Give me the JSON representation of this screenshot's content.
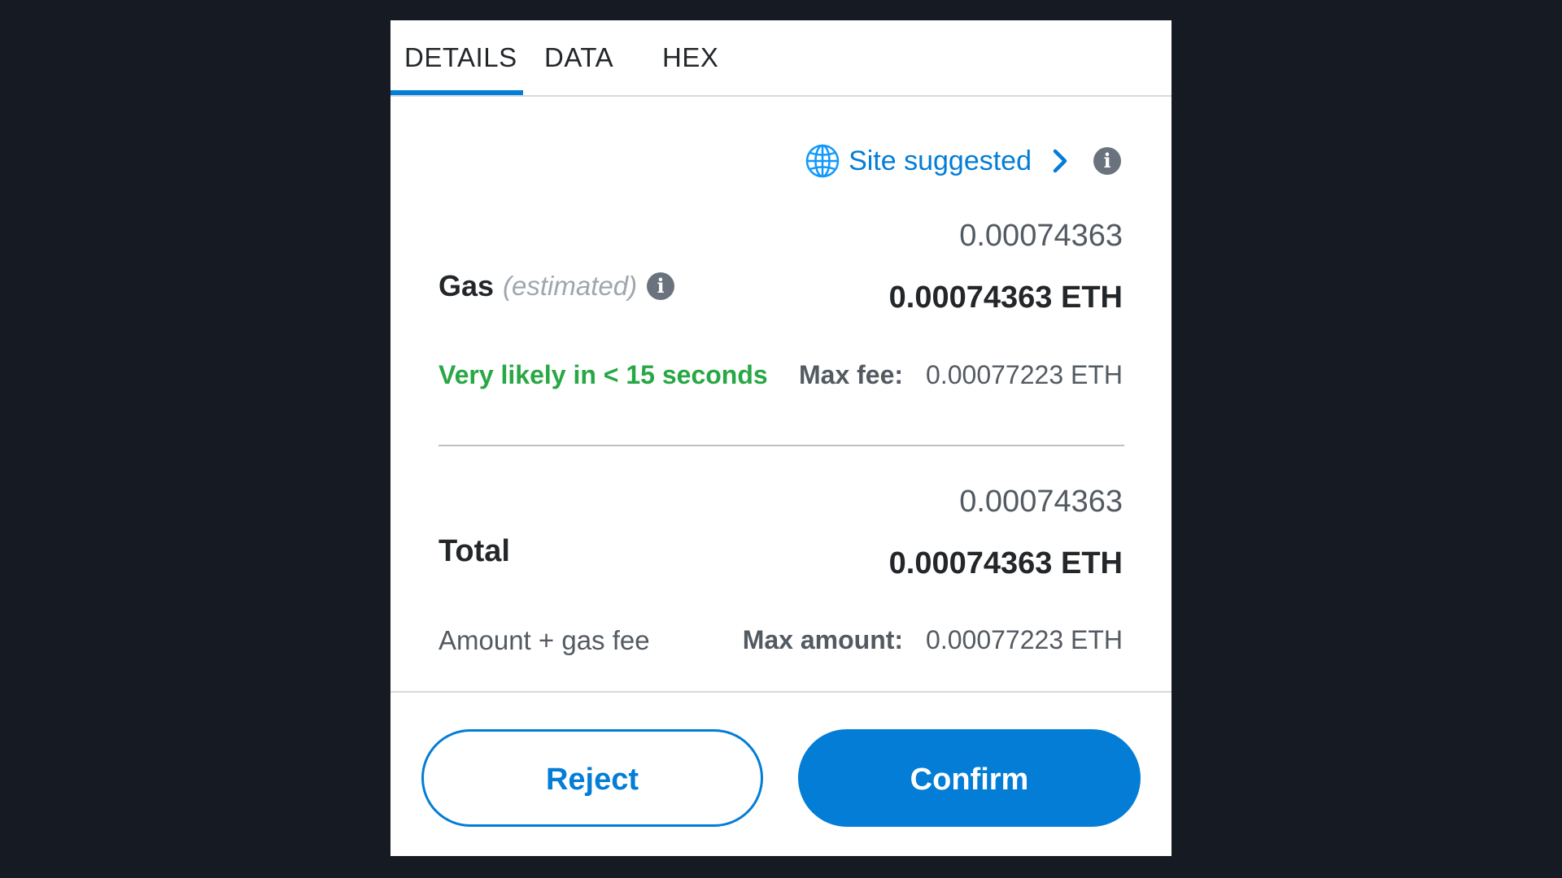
{
  "tabs": [
    {
      "label": "DETAILS",
      "active": true
    },
    {
      "label": "DATA",
      "active": false
    },
    {
      "label": "HEX",
      "active": false
    }
  ],
  "site_suggested": {
    "label": "Site suggested",
    "icon": "globe-icon",
    "chevron_icon": "chevron-right-icon",
    "info_icon": "info-icon"
  },
  "gas": {
    "title": "Gas",
    "subtitle": "(estimated)",
    "info_icon": "info-icon",
    "amount": "0.00074363",
    "amount_eth": "0.00074363 ETH",
    "likely": "Very likely in < 15 seconds",
    "max_fee_label": "Max fee:",
    "max_fee_value": "0.00077223 ETH"
  },
  "total": {
    "title": "Total",
    "amount": "0.00074363",
    "amount_eth": "0.00074363 ETH",
    "subtitle": "Amount + gas fee",
    "max_amount_label": "Max amount:",
    "max_amount_value": "0.00077223 ETH"
  },
  "buttons": {
    "reject": "Reject",
    "confirm": "Confirm"
  },
  "colors": {
    "accent": "#037dd6",
    "success": "#28a745",
    "background": "#161a22"
  }
}
